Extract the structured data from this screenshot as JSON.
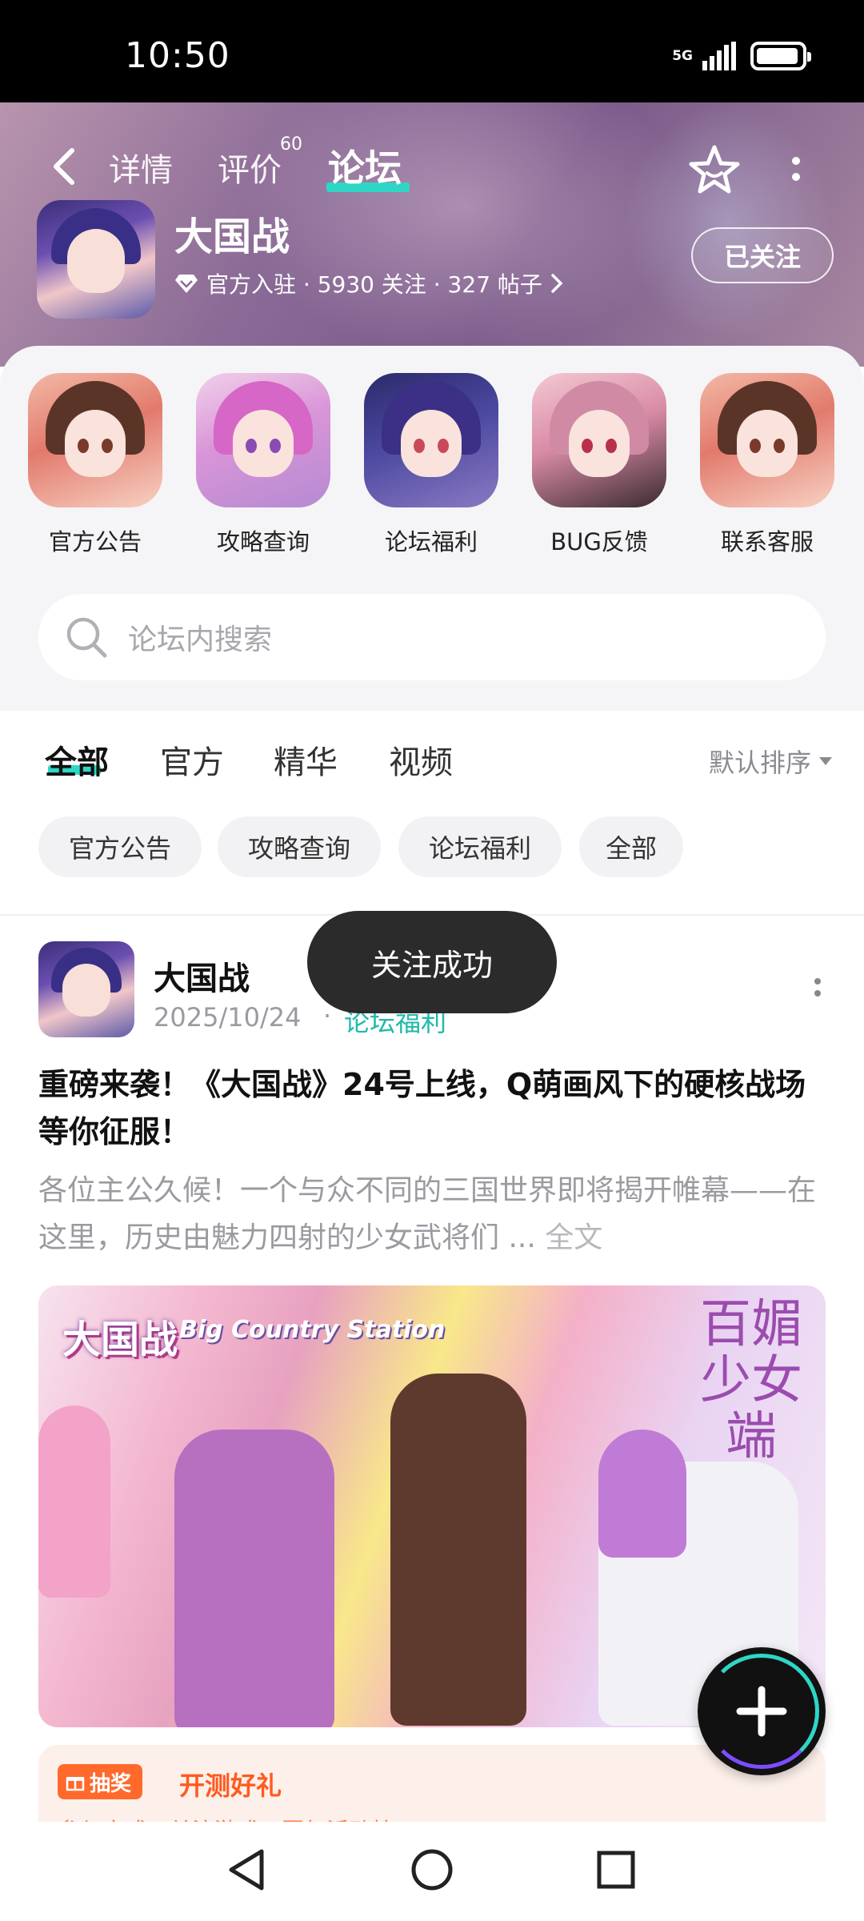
{
  "status_bar": {
    "time": "10:50",
    "network": "5G",
    "battery_level": 0.95
  },
  "header": {
    "tabs": [
      {
        "label": "详情"
      },
      {
        "label": "评价",
        "badge": "60"
      },
      {
        "label": "论坛",
        "active": true
      }
    ],
    "accent_color": "#2fd6c6"
  },
  "game": {
    "name": "大国战",
    "meta": "官方入驻 · 5930 关注 · 327 帖子",
    "follow_label": "已关注"
  },
  "shortcuts": [
    {
      "label": "官方公告"
    },
    {
      "label": "攻略查询"
    },
    {
      "label": "论坛福利"
    },
    {
      "label": "BUG反馈"
    },
    {
      "label": "联系客服"
    }
  ],
  "search": {
    "placeholder": "论坛内搜索"
  },
  "category_tabs": {
    "items": [
      "全部",
      "官方",
      "精华",
      "视频"
    ],
    "active": "全部",
    "sort_label": "默认排序"
  },
  "filter_chips": [
    "官方公告",
    "攻略查询",
    "论坛福利",
    "全部"
  ],
  "post": {
    "author": "大国战",
    "date": "2025/10/24",
    "separator": "·",
    "board": "论坛福利",
    "title": "重磅来袭！《大国战》24号上线，Q萌画风下的硬核战场等你征服！",
    "excerpt": "各位主公久候！一个与众不同的三国世界即将揭开帷幕——在这里，历史由魅力四射的少女武将们 ...",
    "read_more": "全文",
    "image_logo": "大国战",
    "image_logo_sub": "Big Country Station",
    "image_slogan": "百媚少女端",
    "promo_tag": "抽奖",
    "promo_title": "开测好礼",
    "promo_sub": "参与方式：关注游戏，回复活动帖..."
  },
  "toast": "关注成功"
}
